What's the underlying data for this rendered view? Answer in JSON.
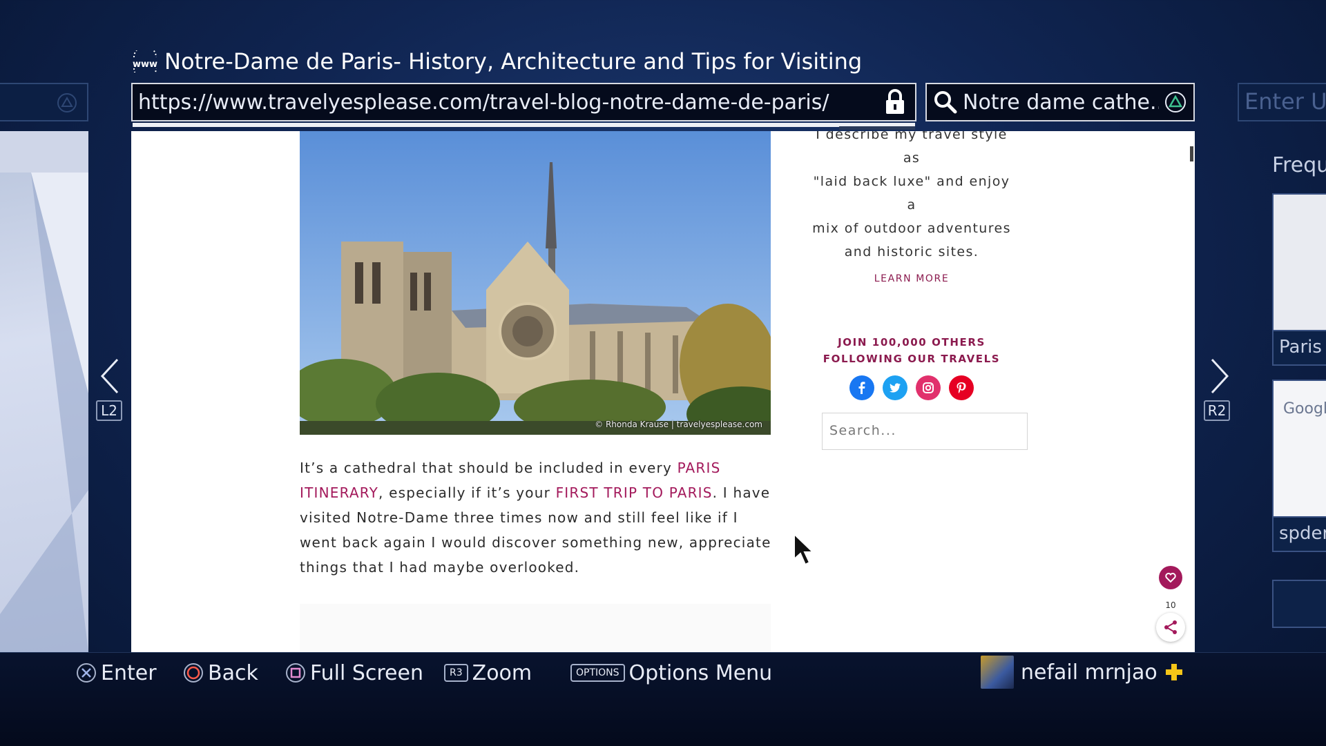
{
  "window": {
    "title": "Notre-Dame de Paris- History, Architecture and Tips for Visiting"
  },
  "address_bar": {
    "url": "https://www.travelyesplease.com/travel-blog-notre-dame-de-paris/",
    "load_progress": 1.0
  },
  "search_bar": {
    "text": "Notre dame cathe..."
  },
  "adjacent_tab_right": {
    "placeholder": "Enter UR",
    "panel_title": "Frequ",
    "thumb1_label": "Paris I",
    "thumb2_label": "spder",
    "thumb2_logo": "Google"
  },
  "nav": {
    "left_key": "L2",
    "right_key": "R2"
  },
  "page": {
    "image_credit": "© Rhonda Krause | travelyesplease.com",
    "article": {
      "seg1": "It’s a cathedral that should be included in every ",
      "link1": "PARIS ITINERARY",
      "seg2": ", especially if it’s your ",
      "link2": "FIRST TRIP TO PARIS",
      "seg3": ". I have visited Notre-Dame three times now and still feel like if I went back again I would discover something new, appreciate things that I had maybe overlooked."
    },
    "sidebar": {
      "about_line1": "I describe my travel style as",
      "about_line2": "\"laid back luxe\" and enjoy a",
      "about_line3": "mix of outdoor adventures",
      "about_line4": "and historic sites.",
      "learn_more": "LEARN MORE",
      "join_line1": "JOIN 100,000 OTHERS",
      "join_line2": "FOLLOWING OUR TRAVELS",
      "social": [
        "facebook-icon",
        "twitter-icon",
        "instagram-icon",
        "pinterest-icon"
      ],
      "search_placeholder": "Search..."
    },
    "share_count": "10"
  },
  "bottom_bar": {
    "enter": "Enter",
    "back": "Back",
    "full_screen": "Full Screen",
    "zoom_key": "R3",
    "zoom": "Zoom",
    "options_key": "OPTIONS",
    "options": "Options Menu",
    "username": "nefail mrnjao"
  },
  "colors": {
    "accent": "#a3195b",
    "background": "#102552",
    "facebook": "#1877f2",
    "twitter": "#1da1f2",
    "instagram": "#e1306c",
    "pinterest": "#e60023"
  }
}
